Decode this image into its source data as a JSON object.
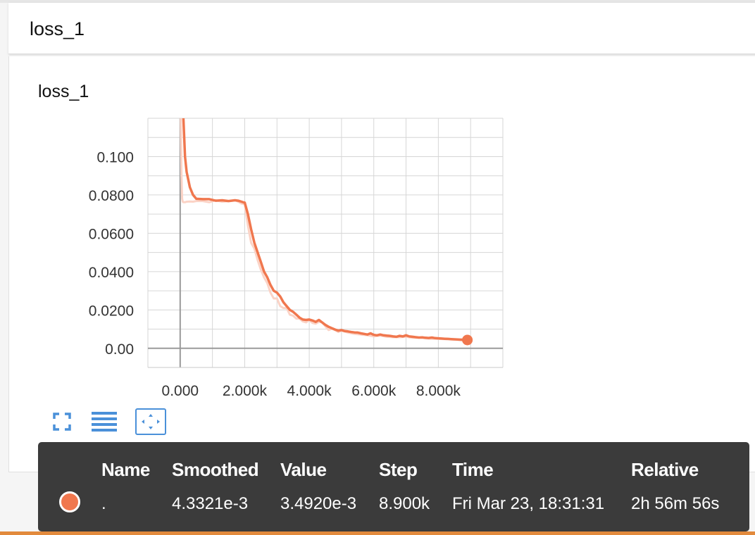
{
  "header": {
    "title": "loss_1"
  },
  "chart_data": {
    "type": "line",
    "title": "loss_1",
    "xlabel": "",
    "ylabel": "",
    "xlim": [
      -1000,
      10000
    ],
    "ylim": [
      -0.01,
      0.12
    ],
    "x_ticks": [
      0,
      2000,
      4000,
      6000,
      8000
    ],
    "x_tick_labels": [
      "0.000",
      "2.000k",
      "4.000k",
      "6.000k",
      "8.000k"
    ],
    "y_ticks": [
      0,
      0.02,
      0.04,
      0.06,
      0.08,
      0.1
    ],
    "y_tick_labels": [
      "0.00",
      "0.0200",
      "0.0400",
      "0.0600",
      "0.0800",
      "0.100"
    ],
    "grid": true,
    "series": [
      {
        "name": ".",
        "color": "#f0774e",
        "smoothed": true,
        "x": [
          0,
          50,
          100,
          150,
          200,
          300,
          400,
          500,
          700,
          900,
          1100,
          1300,
          1500,
          1700,
          1800,
          1900,
          1950,
          2000,
          2100,
          2200,
          2300,
          2400,
          2500,
          2600,
          2700,
          2800,
          2900,
          3000,
          3100,
          3200,
          3300,
          3400,
          3500,
          3600,
          3700,
          3800,
          3900,
          4000,
          4100,
          4200,
          4300,
          4400,
          4500,
          4600,
          4700,
          4800,
          4900,
          5000,
          5100,
          5200,
          5300,
          5400,
          5500,
          5600,
          5700,
          5800,
          5900,
          6000,
          6100,
          6200,
          6300,
          6400,
          6500,
          6600,
          6700,
          6800,
          6900,
          7000,
          7100,
          7200,
          7300,
          7400,
          7500,
          7600,
          7700,
          7800,
          7900,
          8000,
          8100,
          8200,
          8300,
          8400,
          8500,
          8600,
          8700,
          8800,
          8900
        ],
        "y": [
          0.28,
          0.15,
          0.12,
          0.1,
          0.092,
          0.084,
          0.08,
          0.078,
          0.0778,
          0.0778,
          0.077,
          0.0772,
          0.0768,
          0.0772,
          0.077,
          0.0765,
          0.0762,
          0.076,
          0.07,
          0.062,
          0.055,
          0.05,
          0.045,
          0.04,
          0.037,
          0.033,
          0.03,
          0.029,
          0.027,
          0.024,
          0.022,
          0.02,
          0.019,
          0.0175,
          0.016,
          0.015,
          0.0148,
          0.015,
          0.0145,
          0.0138,
          0.0148,
          0.0135,
          0.0122,
          0.0112,
          0.0105,
          0.0098,
          0.0092,
          0.0095,
          0.009,
          0.0088,
          0.0085,
          0.0083,
          0.0082,
          0.0078,
          0.0075,
          0.0072,
          0.0078,
          0.007,
          0.0068,
          0.0072,
          0.0068,
          0.0066,
          0.0065,
          0.0062,
          0.006,
          0.0065,
          0.0062,
          0.0068,
          0.0062,
          0.006,
          0.0058,
          0.0056,
          0.0057,
          0.0055,
          0.0054,
          0.0056,
          0.0053,
          0.0052,
          0.0051,
          0.005,
          0.0049,
          0.0048,
          0.0047,
          0.0046,
          0.0045,
          0.0045,
          0.00433
        ]
      },
      {
        "name": ".",
        "color": "#fbd3c6",
        "smoothed": false,
        "x": [
          0,
          20,
          40,
          60,
          80,
          100,
          150,
          200,
          300,
          400,
          500,
          700,
          900,
          1100,
          1300,
          1500,
          1700,
          1800,
          1900,
          2000,
          2100,
          2200,
          2300,
          2400,
          2500,
          2600,
          2700,
          2800,
          2900,
          3000,
          3100,
          3200,
          3300,
          3400,
          3500,
          3600,
          3700,
          3800,
          3900,
          4000,
          4100,
          4200,
          4300,
          4400,
          4500,
          4600,
          4700,
          4800,
          4900,
          5000,
          5200,
          5400,
          5600,
          5800,
          6000,
          6200,
          6400,
          6600,
          6800,
          7000,
          7200,
          7400,
          7600,
          7800,
          8000,
          8200,
          8400,
          8600,
          8800,
          8900
        ],
        "y": [
          0.28,
          0.12,
          0.09,
          0.078,
          0.0765,
          0.0762,
          0.0762,
          0.0765,
          0.0766,
          0.0765,
          0.0768,
          0.0768,
          0.0762,
          0.0772,
          0.0765,
          0.0768,
          0.0772,
          0.0765,
          0.0755,
          0.0752,
          0.064,
          0.055,
          0.052,
          0.046,
          0.041,
          0.037,
          0.034,
          0.029,
          0.026,
          0.026,
          0.022,
          0.021,
          0.021,
          0.0175,
          0.017,
          0.0155,
          0.0155,
          0.014,
          0.0135,
          0.0148,
          0.0132,
          0.0128,
          0.0138,
          0.0135,
          0.0115,
          0.0095,
          0.0102,
          0.0095,
          0.0085,
          0.0092,
          0.0082,
          0.0075,
          0.0072,
          0.0068,
          0.0062,
          0.0066,
          0.006,
          0.0058,
          0.0058,
          0.006,
          0.0055,
          0.0055,
          0.0052,
          0.005,
          0.0049,
          0.0048,
          0.0046,
          0.0044,
          0.004,
          0.00349
        ]
      }
    ]
  },
  "toolbar": {
    "buttons": [
      {
        "icon": "fullscreen-icon",
        "active": false
      },
      {
        "icon": "lines-icon",
        "active": false
      },
      {
        "icon": "fit-domain-icon",
        "active": true
      }
    ],
    "accent_color": "#4a90d9"
  },
  "tooltip": {
    "headers": [
      "Name",
      "Smoothed",
      "Value",
      "Step",
      "Time",
      "Relative"
    ],
    "row": {
      "name": ".",
      "smoothed": "4.3321e-3",
      "value": "3.4920e-3",
      "step": "8.900k",
      "time": "Fri Mar 23, 18:31:31",
      "relative": "2h 56m 56s"
    },
    "swatch_color": "#f0774e"
  }
}
